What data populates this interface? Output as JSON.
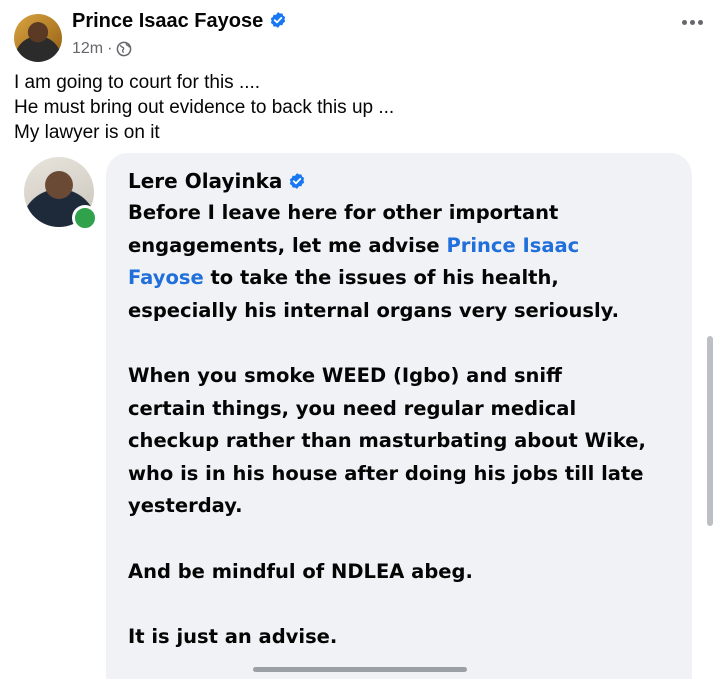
{
  "post": {
    "author": "Prince Isaac Fayose",
    "time": "12m",
    "separator": "·",
    "text_lines": [
      "I am going to court for this ....",
      "He must bring out evidence to back this up ...",
      "My lawyer is on it"
    ]
  },
  "comment": {
    "author": "Lere Olayinka",
    "p1_line1": "Before I leave here for other important",
    "p1_line2": "engagements,  let me advise ",
    "p1_mention_a": "Prince Isaac",
    "p1_mention_b": "Fayose",
    "p1_line3_rest": " to take the issues of his health,",
    "p1_line4": "especially his internal organs very seriously.",
    "p2_lines": [
      "When you smoke WEED (Igbo) and sniff",
      "certain things, you need regular medical",
      "checkup rather than masturbating about Wike,",
      "who is in his house after doing his jobs till late",
      "yesterday."
    ],
    "p3": "And be mindful of NDLEA abeg.",
    "p4": "It is just an advise."
  },
  "icons": {
    "verified": "verified-badge-icon",
    "globe": "globe-icon",
    "more": "more-options-icon",
    "online": "online-status-icon"
  },
  "colors": {
    "verified": "#1877f2",
    "mention": "#216fdb",
    "bubble": "#f0f2f5",
    "online": "#31a24c",
    "meta": "#65676b"
  }
}
